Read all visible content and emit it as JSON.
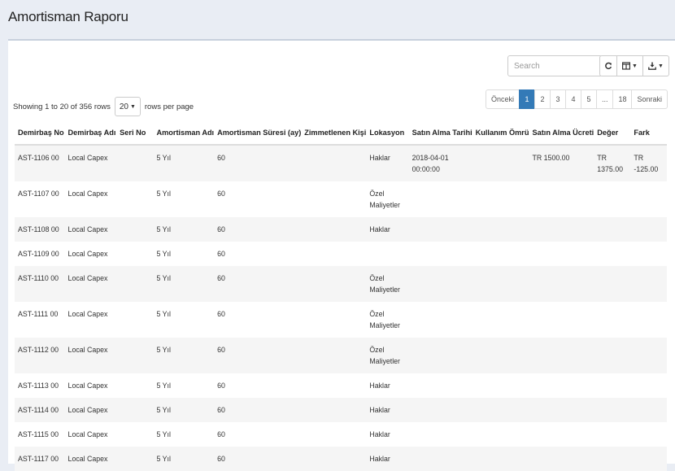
{
  "header": {
    "title": "Amortisman Raporu"
  },
  "toolbar": {
    "search_placeholder": "Search",
    "refresh_icon": "refresh-icon",
    "columns_icon": "columns-icon",
    "export_icon": "download-icon"
  },
  "info": {
    "showing": "Showing 1 to 20 of 356 rows",
    "page_size": "20",
    "per_page": "rows per page"
  },
  "pagination": {
    "prev": "Önceki",
    "pages": [
      "1",
      "2",
      "3",
      "4",
      "5",
      "...",
      "18"
    ],
    "active": "1",
    "next": "Sonraki"
  },
  "table": {
    "columns": [
      "Demirbaş No",
      "Demirbaş Adı",
      "Seri No",
      "Amortisman Adı",
      "Amortisman Süresi (ay)",
      "Zimmetlenen Kişi",
      "Lokasyon",
      "Satın Alma Tarihi",
      "Kullanım Ömrü",
      "Satın Alma Ücreti",
      "Değer",
      "Fark"
    ],
    "rows": [
      [
        "AST-1106 00",
        "Local Capex",
        "",
        "5 Yıl",
        "60",
        "",
        "Haklar",
        "2018-04-01 00:00:00",
        "",
        "TR 1500.00",
        "TR 1375.00",
        "TR -125.00"
      ],
      [
        "AST-1107 00",
        "Local Capex",
        "",
        "5 Yıl",
        "60",
        "",
        "Özel Maliyetler",
        "",
        "",
        "",
        "",
        ""
      ],
      [
        "AST-1108 00",
        "Local Capex",
        "",
        "5 Yıl",
        "60",
        "",
        "Haklar",
        "",
        "",
        "",
        "",
        ""
      ],
      [
        "AST-1109 00",
        "Local Capex",
        "",
        "5 Yıl",
        "60",
        "",
        "",
        "",
        "",
        "",
        "",
        ""
      ],
      [
        "AST-1110 00",
        "Local Capex",
        "",
        "5 Yıl",
        "60",
        "",
        "Özel Maliyetler",
        "",
        "",
        "",
        "",
        ""
      ],
      [
        "AST-1111 00",
        "Local Capex",
        "",
        "5 Yıl",
        "60",
        "",
        "Özel Maliyetler",
        "",
        "",
        "",
        "",
        ""
      ],
      [
        "AST-1112 00",
        "Local Capex",
        "",
        "5 Yıl",
        "60",
        "",
        "Özel Maliyetler",
        "",
        "",
        "",
        "",
        ""
      ],
      [
        "AST-1113 00",
        "Local Capex",
        "",
        "5 Yıl",
        "60",
        "",
        "Haklar",
        "",
        "",
        "",
        "",
        ""
      ],
      [
        "AST-1114 00",
        "Local Capex",
        "",
        "5 Yıl",
        "60",
        "",
        "Haklar",
        "",
        "",
        "",
        "",
        ""
      ],
      [
        "AST-1115 00",
        "Local Capex",
        "",
        "5 Yıl",
        "60",
        "",
        "Haklar",
        "",
        "",
        "",
        "",
        ""
      ],
      [
        "AST-1117 00",
        "Local Capex",
        "",
        "5 Yıl",
        "60",
        "",
        "Haklar",
        "",
        "",
        "",
        "",
        ""
      ]
    ]
  },
  "colors": {
    "accent": "#337ab7",
    "header_bg": "#e9edf4"
  }
}
